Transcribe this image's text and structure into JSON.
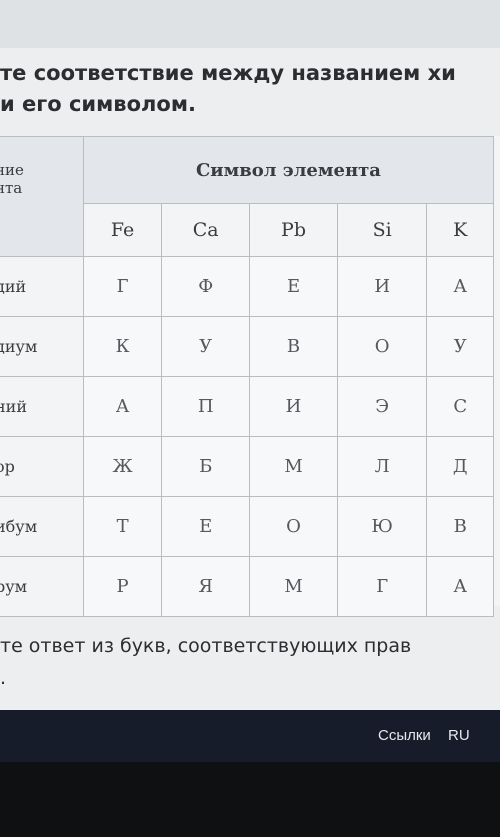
{
  "instruction": {
    "line1": "те соответствие между названием хи",
    "line2": "и его символом."
  },
  "table": {
    "header_left_line1": "ние",
    "header_left_line2": "нта",
    "header_group": "Символ элемента",
    "symbols": [
      "Fe",
      "Ca",
      "Pb",
      "Si",
      "K"
    ],
    "rows": [
      {
        "name": "дий",
        "letters": [
          "Г",
          "Ф",
          "Е",
          "И",
          "А"
        ]
      },
      {
        "name": "диум",
        "letters": [
          "К",
          "У",
          "В",
          "О",
          "У"
        ]
      },
      {
        "name": "ний",
        "letters": [
          "А",
          "П",
          "И",
          "Э",
          "С"
        ]
      },
      {
        "name": "ор",
        "letters": [
          "Ж",
          "Б",
          "М",
          "Л",
          "Д"
        ]
      },
      {
        "name": "ибум",
        "letters": [
          "Т",
          "Е",
          "О",
          "Ю",
          "В"
        ]
      },
      {
        "name": "рум",
        "letters": [
          "Р",
          "Я",
          "М",
          "Г",
          "А"
        ]
      }
    ]
  },
  "bottom": {
    "line1": "те ответ из букв, соответствующих прав",
    "line2": "."
  },
  "taskbar": {
    "links_label": "Ссылки",
    "language": "RU"
  }
}
